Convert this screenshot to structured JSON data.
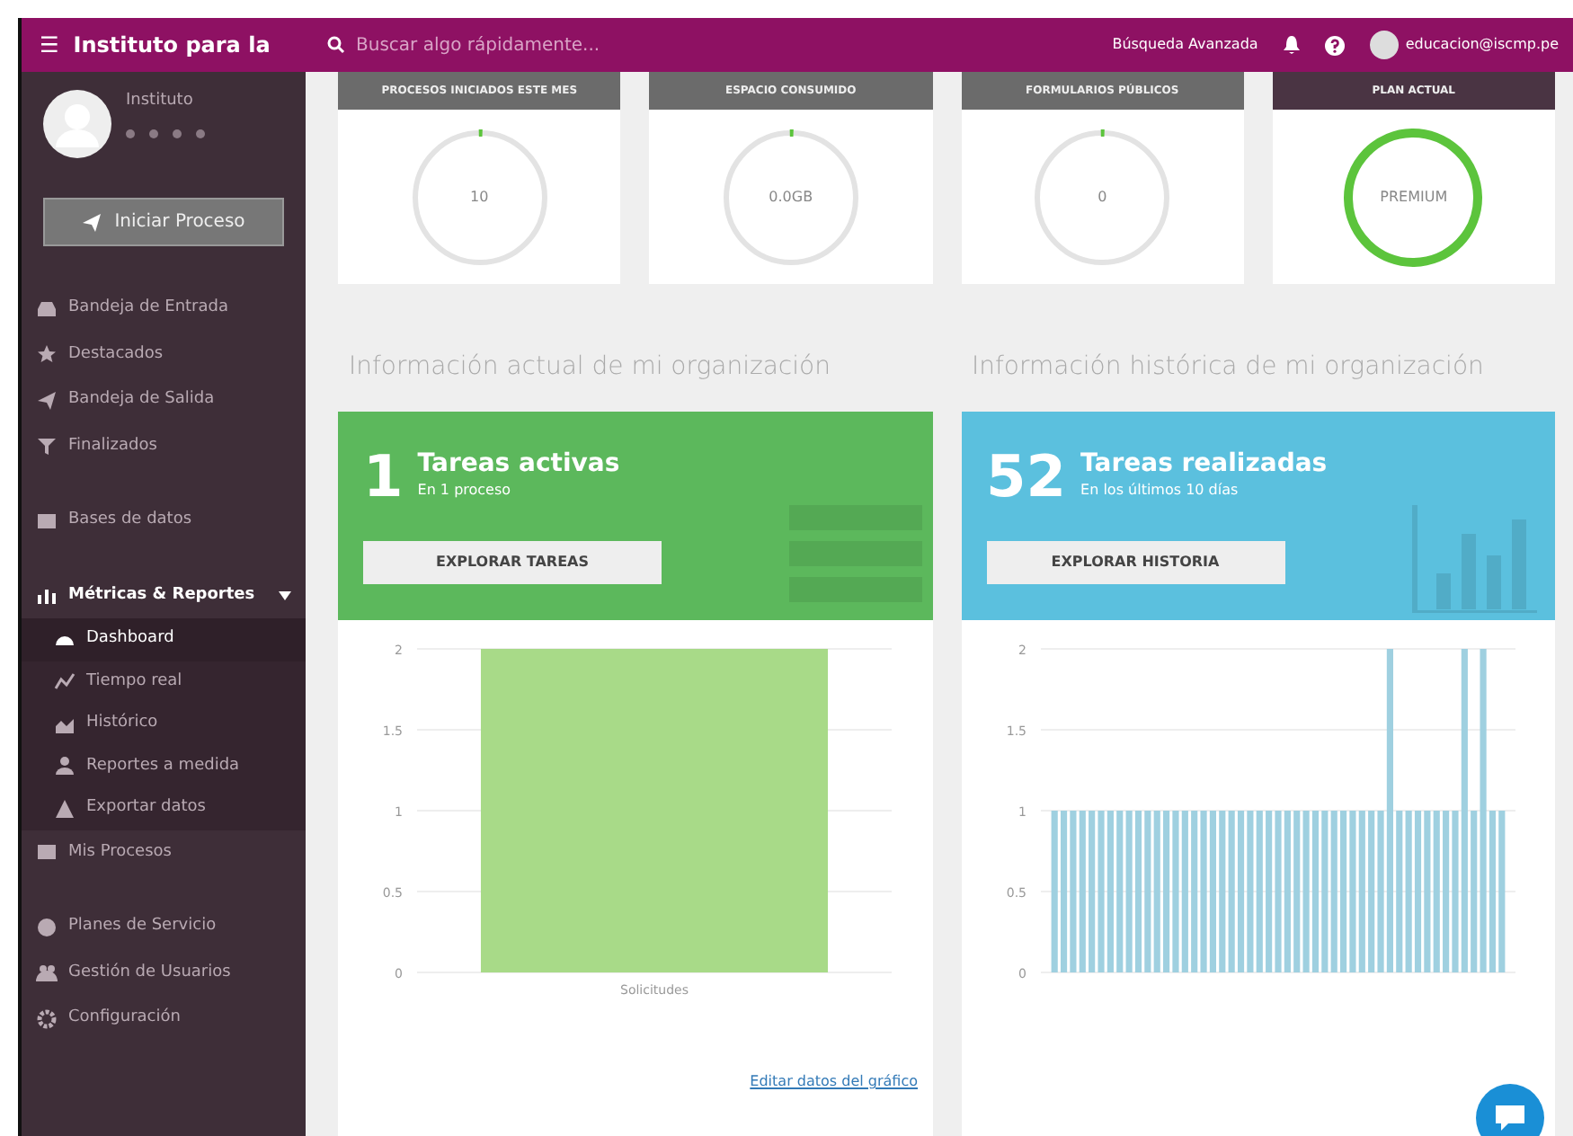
{
  "topbar": {
    "brand": "Instituto para la",
    "menu_icon": "☰",
    "search": {
      "placeholder": "Buscar algo rápidamente..."
    },
    "advanced_search": "Búsqueda Avanzada",
    "user_email": "educacion@iscmp.pe"
  },
  "sidebar": {
    "profile": {
      "name": "Instituto",
      "stars": 0
    },
    "start_button": "Iniciar Proceso",
    "items": [
      {
        "label": "Bandeja de Entrada",
        "expanded": false,
        "selected": false
      },
      {
        "label": "Destacados",
        "expanded": false,
        "selected": false
      },
      {
        "label": "Bandeja de Salida",
        "expanded": false,
        "selected": false
      },
      {
        "label": "Finalizados",
        "expanded": false,
        "selected": false
      },
      {
        "label": "Bases de datos",
        "expanded": false,
        "selected": false
      },
      {
        "label": "Métricas & Reportes",
        "expanded": true,
        "selected": false,
        "children": [
          {
            "label": "Dashboard",
            "selected": true
          },
          {
            "label": "Tiempo real",
            "selected": false
          },
          {
            "label": "Histórico",
            "selected": false
          },
          {
            "label": "Reportes a medida",
            "selected": false
          },
          {
            "label": "Exportar datos",
            "selected": false
          }
        ]
      },
      {
        "label": "Mis Procesos",
        "expanded": false,
        "selected": false
      },
      {
        "label": "Planes de Servicio",
        "expanded": false,
        "selected": false
      },
      {
        "label": "Gestión de Usuarios",
        "expanded": false,
        "selected": false
      },
      {
        "label": "Configuración",
        "expanded": false,
        "selected": false
      }
    ]
  },
  "stats": [
    {
      "title": "PROCESOS INICIADOS ESTE MES",
      "value": "10",
      "level": 0
    },
    {
      "title": "ESPACIO CONSUMIDO",
      "value": "0.0GB",
      "level": 0
    },
    {
      "title": "FORMULARIOS PÚBLICOS",
      "value": "0",
      "level": 0
    },
    {
      "title": "PLAN ACTUAL",
      "value": "PREMIUM",
      "level": 1
    }
  ],
  "panels": [
    {
      "heading": "Información actual de mi organización",
      "color": "#5cb85c",
      "count": "1",
      "title": "Tareas activas",
      "subtitle": "En 1 proceso",
      "button": "EXPLORAR TAREAS",
      "chart_data": {
        "type": "bar",
        "grid": true,
        "categories": [
          "Solicitudes"
        ],
        "series": [
          {
            "color": "#a8da88",
            "values": [
              2
            ]
          }
        ],
        "ylim": [
          0,
          2
        ],
        "yticks": [
          0,
          0.5,
          1,
          1.5,
          2
        ]
      },
      "link": "Editar datos del gráfico"
    },
    {
      "heading": "Información histórica de mi organización",
      "color": "#5bc0de",
      "count": "52",
      "title": "Tareas realizadas",
      "subtitle": "En los últimos 10 días",
      "button": "EXPLORAR HISTORIA",
      "chart_data": {
        "type": "bar",
        "grid": true,
        "series": [
          {
            "color": "#9fd0e0",
            "values": [
              1,
              1,
              1,
              1,
              1,
              1,
              1,
              1,
              1,
              1,
              1,
              1,
              1,
              1,
              1,
              1,
              1,
              1,
              1,
              1,
              1,
              1,
              1,
              1,
              1,
              1,
              1,
              1,
              1,
              1,
              1,
              1,
              1,
              1,
              1,
              1,
              2,
              1,
              1,
              1,
              1,
              1,
              1,
              1,
              2,
              1,
              2,
              1,
              1
            ]
          }
        ],
        "ylim": [
          0,
          2
        ],
        "yticks": [
          0,
          0.5,
          1,
          1.5,
          2
        ]
      }
    }
  ]
}
